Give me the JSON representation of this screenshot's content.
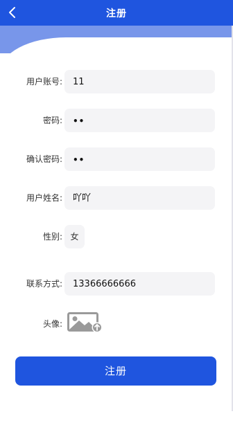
{
  "header": {
    "title": "注册"
  },
  "form": {
    "account_label": "用户账号:",
    "account_value": "11",
    "password_label": "密码:",
    "password_value": "••",
    "confirm_label": "确认密码:",
    "confirm_value": "••",
    "name_label": "用户姓名:",
    "name_value": "吖吖",
    "gender_label": "性别:",
    "gender_value": "女",
    "contact_label": "联系方式:",
    "contact_value": "13366666666",
    "avatar_label": "头像:"
  },
  "submit_label": "注册",
  "icons": {
    "back": "chevron-left-icon",
    "avatar": "image-upload-icon"
  },
  "colors": {
    "primary": "#1f55df",
    "band": "#7896ea",
    "field_bg": "#f4f4f6"
  }
}
